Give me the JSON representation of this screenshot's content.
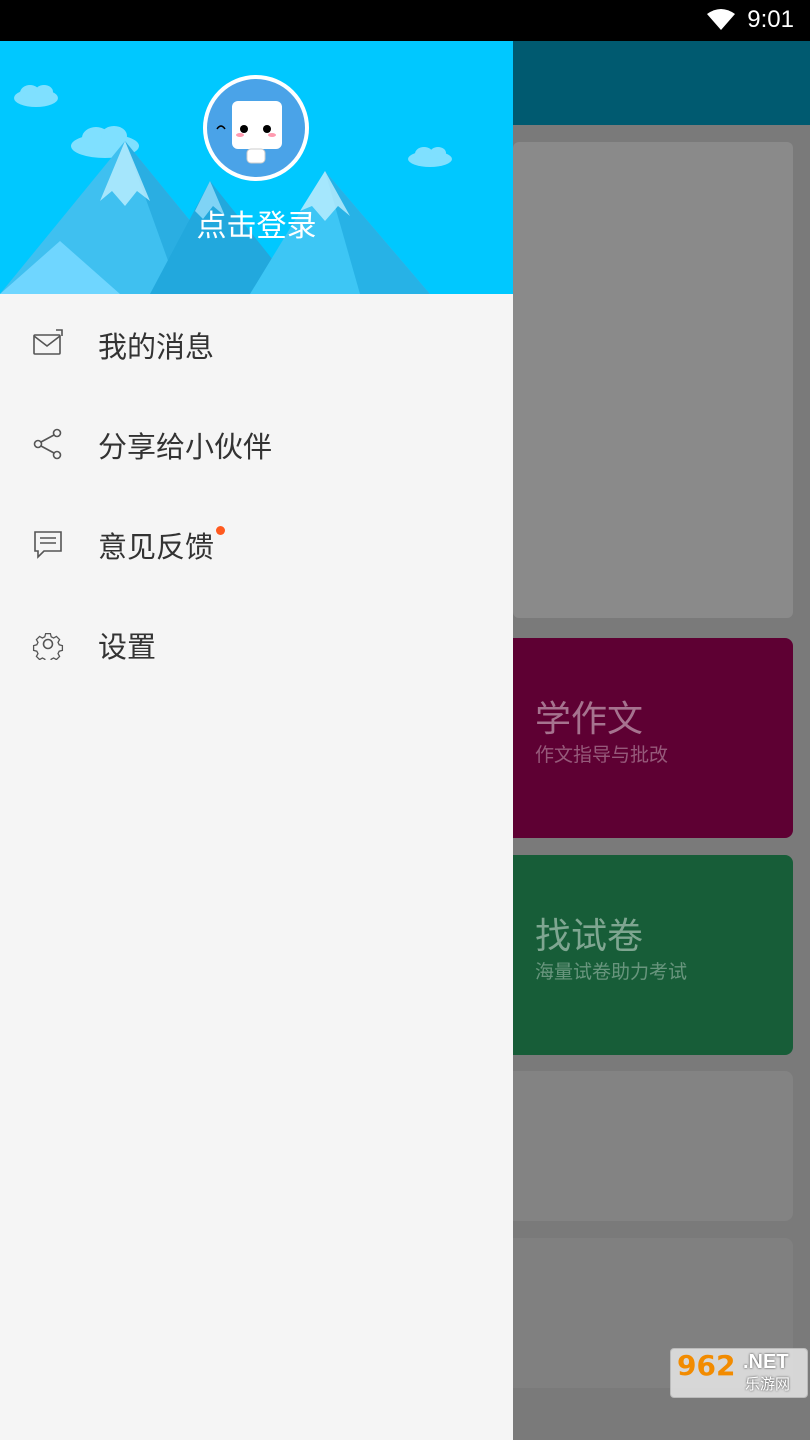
{
  "status_bar": {
    "time": "9:01",
    "wifi_icon": "wifi-icon"
  },
  "drawer": {
    "login_text": "点击登录",
    "menu": [
      {
        "label": "我的消息",
        "icon": "mail-icon"
      },
      {
        "label": "分享给小伙伴",
        "icon": "share-icon"
      },
      {
        "label": "意见反馈",
        "icon": "feedback-icon",
        "badge": true
      },
      {
        "label": "设置",
        "icon": "gear-icon"
      }
    ]
  },
  "background": {
    "cards": [
      {
        "title": "学作文",
        "subtitle": "作文指导与批改",
        "color": "#5e0033"
      },
      {
        "title": "找试卷",
        "subtitle": "海量试卷助力考试",
        "color": "#175d38"
      }
    ]
  },
  "watermark": {
    "brand": "962",
    "domain": ".NET",
    "name": "乐游网"
  },
  "colors": {
    "header": "#00c8ff",
    "badge": "#ff5a1f",
    "topbar": "#005a70"
  }
}
